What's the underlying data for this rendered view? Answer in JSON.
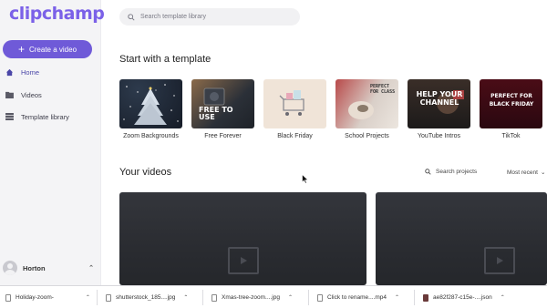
{
  "sidebar": {
    "logo": "clipchamp",
    "create_label": "Create a video",
    "items": [
      {
        "label": "Home"
      },
      {
        "label": "Videos"
      },
      {
        "label": "Template library"
      }
    ],
    "user_name": "Horton"
  },
  "search": {
    "placeholder": "Search template library"
  },
  "templates_section": {
    "title": "Start with a template",
    "items": [
      {
        "label": "Zoom Backgrounds"
      },
      {
        "label": "Free Forever",
        "thumb_text": "FREE TO USE"
      },
      {
        "label": "Black Friday"
      },
      {
        "label": "School Projects",
        "thumb_text": "PERFECT FOR CLASS"
      },
      {
        "label": "YouTube Intros",
        "thumb_text": "HELP YOUR CHANNEL"
      },
      {
        "label": "TikTok",
        "thumb_text": "PERFECT FOR BLACK FRIDAY"
      }
    ]
  },
  "videos_section": {
    "title": "Your videos",
    "search_label": "Search projects",
    "sort_label": "Most recent"
  },
  "downloads": [
    {
      "name": "Holiday-zoom-"
    },
    {
      "name": "shutterstock_185....jpg"
    },
    {
      "name": "Xmas-tree-zoom....jpg"
    },
    {
      "name": "Click to rename....mp4"
    },
    {
      "name": "ae82f287-c15e-....json"
    }
  ],
  "colors": {
    "accent": "#6f5ad8",
    "logo": "#7b61e8",
    "sidebar_bg": "#f4f4f6"
  }
}
